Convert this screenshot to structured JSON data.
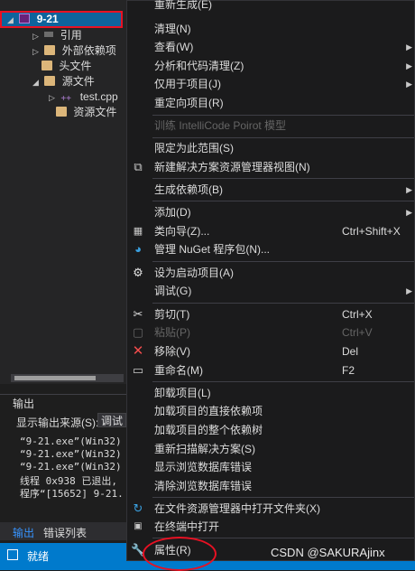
{
  "explorer": {
    "project_label": "9-21",
    "items": [
      {
        "label": "引用"
      },
      {
        "label": "外部依赖项"
      },
      {
        "label": "头文件"
      },
      {
        "label": "源文件"
      },
      {
        "label": "test.cpp"
      },
      {
        "label": "资源文件"
      }
    ]
  },
  "output": {
    "title": "输出",
    "source_label": "显示输出来源(S):",
    "source_value": "调试",
    "lines": [
      "“9-21.exe”(Win32)",
      "“9-21.exe”(Win32)",
      "“9-21.exe”(Win32)",
      "线程 0x938 已退出,",
      "程序“[15652] 9-21."
    ],
    "tabs": [
      "输出",
      "错误列表"
    ]
  },
  "status": {
    "text": "就绪"
  },
  "menu": {
    "items": [
      {
        "label": "重新生成(E)",
        "shortcut": "",
        "submenu": false,
        "disabled": false
      },
      {
        "label": "清理(N)",
        "shortcut": "",
        "submenu": false,
        "disabled": false
      },
      {
        "label": "查看(W)",
        "shortcut": "",
        "submenu": true,
        "disabled": false
      },
      {
        "label": "分析和代码清理(Z)",
        "shortcut": "",
        "submenu": true,
        "disabled": false
      },
      {
        "label": "仅用于项目(J)",
        "shortcut": "",
        "submenu": true,
        "disabled": false
      },
      {
        "label": "重定向项目(R)",
        "shortcut": "",
        "submenu": false,
        "disabled": false
      },
      {
        "label": "训练 IntelliCode Poirot 模型",
        "shortcut": "",
        "submenu": false,
        "disabled": true
      },
      {
        "label": "限定为此范围(S)",
        "shortcut": "",
        "submenu": false,
        "disabled": false
      },
      {
        "label": "新建解决方案资源管理器视图(N)",
        "shortcut": "",
        "submenu": false,
        "disabled": false
      },
      {
        "label": "生成依赖项(B)",
        "shortcut": "",
        "submenu": true,
        "disabled": false
      },
      {
        "label": "添加(D)",
        "shortcut": "",
        "submenu": true,
        "disabled": false
      },
      {
        "label": "类向导(Z)...",
        "shortcut": "Ctrl+Shift+X",
        "submenu": false,
        "disabled": false
      },
      {
        "label": "管理 NuGet 程序包(N)...",
        "shortcut": "",
        "submenu": false,
        "disabled": false
      },
      {
        "label": "设为启动项目(A)",
        "shortcut": "",
        "submenu": false,
        "disabled": false
      },
      {
        "label": "调试(G)",
        "shortcut": "",
        "submenu": true,
        "disabled": false
      },
      {
        "label": "剪切(T)",
        "shortcut": "Ctrl+X",
        "submenu": false,
        "disabled": false
      },
      {
        "label": "粘贴(P)",
        "shortcut": "Ctrl+V",
        "submenu": false,
        "disabled": true
      },
      {
        "label": "移除(V)",
        "shortcut": "Del",
        "submenu": false,
        "disabled": false
      },
      {
        "label": "重命名(M)",
        "shortcut": "F2",
        "submenu": false,
        "disabled": false
      },
      {
        "label": "卸载项目(L)",
        "shortcut": "",
        "submenu": false,
        "disabled": false
      },
      {
        "label": "加载项目的直接依赖项",
        "shortcut": "",
        "submenu": false,
        "disabled": false
      },
      {
        "label": "加载项目的整个依赖树",
        "shortcut": "",
        "submenu": false,
        "disabled": false
      },
      {
        "label": "重新扫描解决方案(S)",
        "shortcut": "",
        "submenu": false,
        "disabled": false
      },
      {
        "label": "显示浏览数据库错误",
        "shortcut": "",
        "submenu": false,
        "disabled": false
      },
      {
        "label": "清除浏览数据库错误",
        "shortcut": "",
        "submenu": false,
        "disabled": false
      },
      {
        "label": "在文件资源管理器中打开文件夹(X)",
        "shortcut": "",
        "submenu": false,
        "disabled": false
      },
      {
        "label": "在终端中打开",
        "shortcut": "",
        "submenu": false,
        "disabled": false
      },
      {
        "label": "属性(R)",
        "shortcut": "",
        "submenu": false,
        "disabled": false
      }
    ]
  },
  "watermark": "CSDN @SAKURAjinx",
  "colors": {
    "accent": "#007acc",
    "highlight": "#e81123",
    "menu_bg": "#1b1b1c"
  }
}
